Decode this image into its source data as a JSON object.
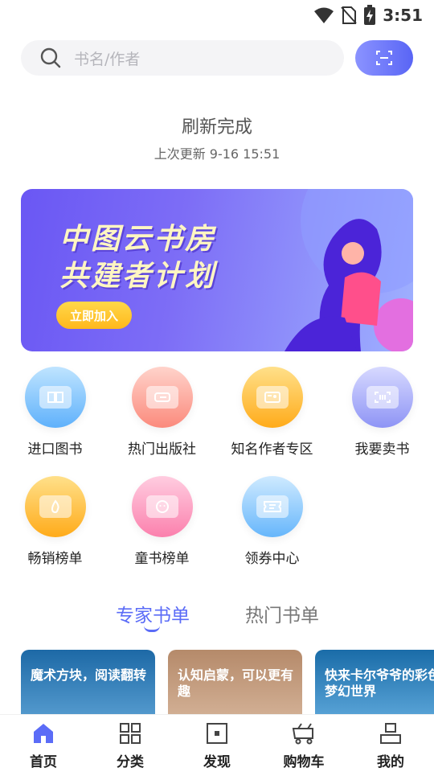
{
  "status_bar": {
    "time": "3:51"
  },
  "search": {
    "placeholder": "书名/作者"
  },
  "refresh": {
    "title": "刷新完成",
    "last_update": "上次更新 9-16 15:51"
  },
  "banner": {
    "line1": "中图云书房",
    "line2": "共建者计划",
    "button": "立即加入"
  },
  "grid": [
    {
      "label": "进口图书"
    },
    {
      "label": "热门出版社"
    },
    {
      "label": "知名作者专区"
    },
    {
      "label": "我要卖书"
    },
    {
      "label": "畅销榜单"
    },
    {
      "label": "童书榜单"
    },
    {
      "label": "领券中心"
    }
  ],
  "tabs": [
    {
      "label": "专家书单"
    },
    {
      "label": "热门书单"
    }
  ],
  "cards": [
    {
      "title": "魔术方块，阅读翻转"
    },
    {
      "title": "认知启蒙，可以更有趣"
    },
    {
      "title": "快来卡尔爷爷的彩色梦幻世界"
    }
  ],
  "nav": [
    {
      "label": "首页"
    },
    {
      "label": "分类"
    },
    {
      "label": "发现"
    },
    {
      "label": "购物车"
    },
    {
      "label": "我的"
    }
  ],
  "colors": {
    "accent": "#5b6cf7",
    "banner_bg": "#6a57f4",
    "button_yellow": "#ffc125"
  }
}
